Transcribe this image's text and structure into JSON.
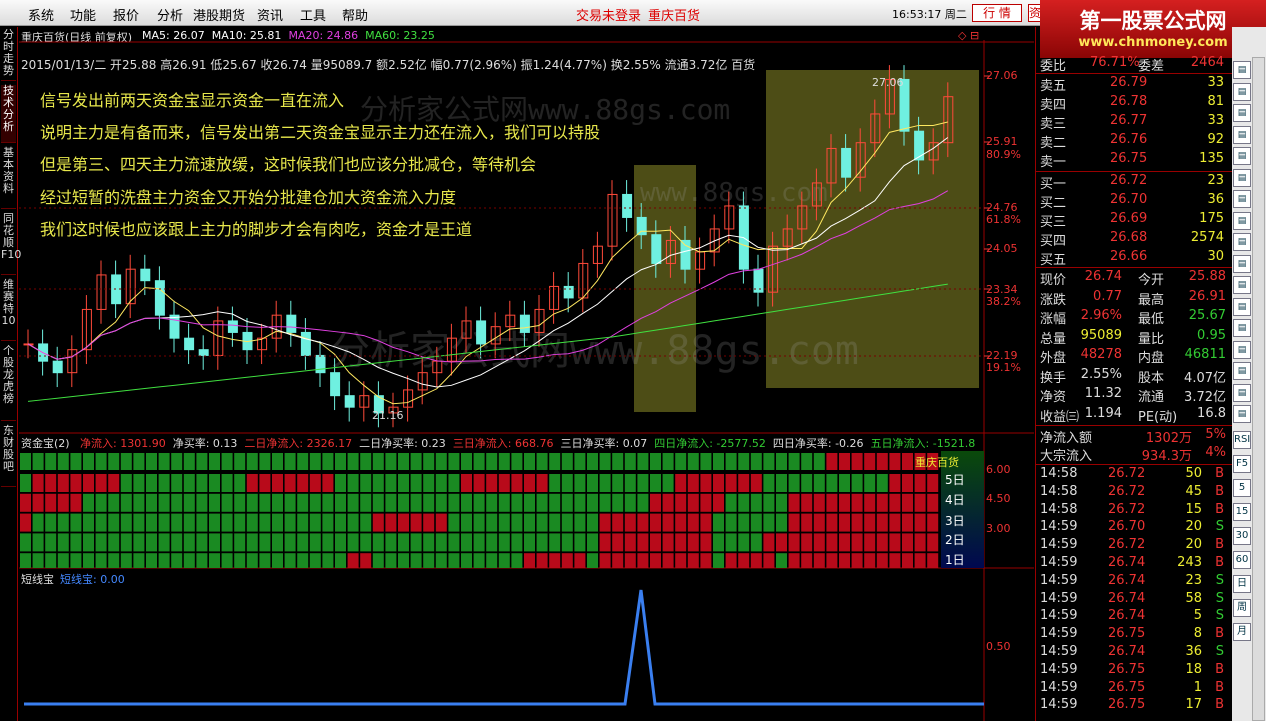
{
  "menu": {
    "items": [
      "系统",
      "功能",
      "报价",
      "分析",
      "港股期货",
      "资讯",
      "工具",
      "帮助"
    ],
    "login": "交易未登录",
    "stock": "重庆百货",
    "time": "16:53:17 周二",
    "btn_trade": "行 情",
    "btn_extra": "资"
  },
  "logo": {
    "line1": "第一股票公式网",
    "line2": "www.chnmoney.com"
  },
  "left_tabs": [
    "分时走势",
    "技术分析",
    "基本资料",
    "同花顺F10",
    "维赛特10",
    "个股龙虎榜",
    "东财股吧"
  ],
  "main": {
    "title": "重庆百货(日线 前复权)",
    "ma": [
      {
        "label": "MA5: 26.07",
        "color": "#ffffff"
      },
      {
        "label": "MA10: 25.81",
        "color": "#ffffff"
      },
      {
        "label": "MA20: 24.86",
        "color": "#e040e0"
      },
      {
        "label": "MA60: 23.25",
        "color": "#40e040"
      }
    ],
    "info": "2015/01/13/二 开25.88 高26.91 低25.67 收26.74 量95089.7 额2.52亿 幅0.77(2.96%) 振1.24(4.77%) 换2.55% 流通3.72亿 百货",
    "annotations": [
      "信号发出前两天资金宝显示资金一直在流入",
      "说明主力是有备而来，信号发出第二天资金宝显示主力还在流入，我们可以持股",
      "但是第三、四天主力流速放缓，这时候我们也应该分批减仓，等待机会",
      "经过短暂的洗盘主力资金又开始分批建仓加大资金流入力度",
      "我们这时候也应该跟上主力的脚步才会有肉吃，资金才是王道"
    ],
    "high_label": "27.06",
    "low_label": "21.16",
    "price_scale": [
      "27.06",
      "25.91",
      "80.9%",
      "24.76",
      "61.8%",
      "24.05",
      "23.34",
      "38.2%",
      "22.19",
      "19.1%"
    ],
    "watermark1": "分析家公式网www.88gs.com",
    "watermark2": "www.88gs.com",
    "watermark3": "分析家公式网www.88gs.com"
  },
  "zjb": {
    "title": "资金宝(2)",
    "items": [
      {
        "label": "净流入: 1301.90",
        "color": "#e33"
      },
      {
        "label": "净买率: 0.13",
        "color": "#ddd"
      },
      {
        "label": "二日净流入: 2326.17",
        "color": "#e33"
      },
      {
        "label": "二日净买率: 0.23",
        "color": "#ddd"
      },
      {
        "label": "三日净流入: 668.76",
        "color": "#e33"
      },
      {
        "label": "三日净买率: 0.07",
        "color": "#ddd"
      },
      {
        "label": "四日净流入: -2577.52",
        "color": "#3c3"
      },
      {
        "label": "四日净买率: -0.26",
        "color": "#ddd"
      },
      {
        "label": "五日净流入: -1521.8",
        "color": "#3c3"
      }
    ],
    "row_labels": [
      "5日",
      "4日",
      "3日",
      "2日",
      "1日"
    ],
    "stock_tag": "重庆百货",
    "scale": [
      "6.00",
      "4.50",
      "3.00"
    ]
  },
  "dxb": {
    "title": "短线宝",
    "value": "短线宝: 0.00",
    "scale": "0.50"
  },
  "quote": {
    "wei": {
      "wb_label": "委比",
      "wb": "76.71%",
      "wc_label": "委差",
      "wc": "2464"
    },
    "sell": [
      {
        "n": "卖五",
        "p": "26.79",
        "v": "33"
      },
      {
        "n": "卖四",
        "p": "26.78",
        "v": "81"
      },
      {
        "n": "卖三",
        "p": "26.77",
        "v": "33"
      },
      {
        "n": "卖二",
        "p": "26.76",
        "v": "92"
      },
      {
        "n": "卖一",
        "p": "26.75",
        "v": "135"
      }
    ],
    "buy": [
      {
        "n": "买一",
        "p": "26.72",
        "v": "23"
      },
      {
        "n": "买二",
        "p": "26.70",
        "v": "36"
      },
      {
        "n": "买三",
        "p": "26.69",
        "v": "175"
      },
      {
        "n": "买四",
        "p": "26.68",
        "v": "2574"
      },
      {
        "n": "买五",
        "p": "26.66",
        "v": "30"
      }
    ],
    "stats": [
      {
        "a": "现价",
        "av": "26.74",
        "ac": "#e33",
        "b": "今开",
        "bv": "25.88",
        "bc": "#e33"
      },
      {
        "a": "涨跌",
        "av": "0.77",
        "ac": "#e33",
        "b": "最高",
        "bv": "26.91",
        "bc": "#e33"
      },
      {
        "a": "涨幅",
        "av": "2.96%",
        "ac": "#e33",
        "b": "最低",
        "bv": "25.67",
        "bc": "#3c3"
      },
      {
        "a": "总量",
        "av": "95089",
        "ac": "#ee3",
        "b": "量比",
        "bv": "0.95",
        "bc": "#3c3"
      },
      {
        "a": "外盘",
        "av": "48278",
        "ac": "#e33",
        "b": "内盘",
        "bv": "46811",
        "bc": "#3c3"
      },
      {
        "a": "换手",
        "av": "2.55%",
        "ac": "#ddd",
        "b": "股本",
        "bv": "4.07亿",
        "bc": "#ddd"
      },
      {
        "a": "净资",
        "av": "11.32",
        "ac": "#ddd",
        "b": "流通",
        "bv": "3.72亿",
        "bc": "#ddd"
      },
      {
        "a": "收益㈢",
        "av": "1.194",
        "ac": "#ddd",
        "b": "PE(动)",
        "bv": "16.8",
        "bc": "#ddd"
      }
    ],
    "flow": [
      {
        "n": "净流入额",
        "v": "1302万",
        "p": "5%"
      },
      {
        "n": "大宗流入",
        "v": "934.3万",
        "p": "4%"
      }
    ],
    "ticks": [
      {
        "t": "14:58",
        "p": "26.72",
        "v": "50",
        "s": "B"
      },
      {
        "t": "14:58",
        "p": "26.72",
        "v": "45",
        "s": "B"
      },
      {
        "t": "14:58",
        "p": "26.72",
        "v": "15",
        "s": "B"
      },
      {
        "t": "14:59",
        "p": "26.70",
        "v": "20",
        "s": "S"
      },
      {
        "t": "14:59",
        "p": "26.72",
        "v": "20",
        "s": "B"
      },
      {
        "t": "14:59",
        "p": "26.74",
        "v": "243",
        "s": "B"
      },
      {
        "t": "14:59",
        "p": "26.74",
        "v": "23",
        "s": "S"
      },
      {
        "t": "14:59",
        "p": "26.74",
        "v": "58",
        "s": "S"
      },
      {
        "t": "14:59",
        "p": "26.74",
        "v": "5",
        "s": "S"
      },
      {
        "t": "14:59",
        "p": "26.75",
        "v": "8",
        "s": "B"
      },
      {
        "t": "14:59",
        "p": "26.74",
        "v": "36",
        "s": "S"
      },
      {
        "t": "14:59",
        "p": "26.75",
        "v": "18",
        "s": "B"
      },
      {
        "t": "14:59",
        "p": "26.75",
        "v": "1",
        "s": "B"
      },
      {
        "t": "14:59",
        "p": "26.75",
        "v": "17",
        "s": "B"
      }
    ]
  },
  "toolbar": {
    "labels": [
      "RSI",
      "F5",
      "5",
      "15",
      "30",
      "60",
      "日",
      "周",
      "月"
    ]
  }
}
